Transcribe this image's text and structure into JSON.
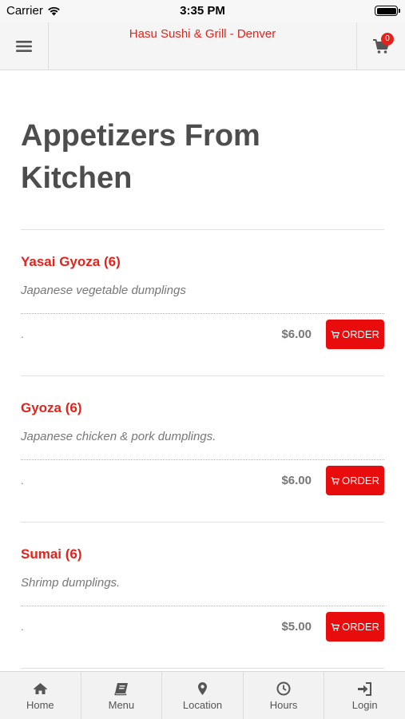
{
  "status_bar": {
    "carrier": "Carrier",
    "time": "3:35 PM"
  },
  "navbar": {
    "title": "Hasu Sushi & Grill - Denver",
    "cart_count": "0"
  },
  "section": {
    "title": "Appetizers From Kitchen"
  },
  "items": [
    {
      "name": "Yasai Gyoza (6)",
      "description": "Japanese vegetable dumplings",
      "note": ".",
      "price": "$6.00",
      "order_label": "ORDER"
    },
    {
      "name": "Gyoza (6)",
      "description": "Japanese chicken & pork dumplings.",
      "note": ".",
      "price": "$6.00",
      "order_label": "ORDER"
    },
    {
      "name": "Sumai (6)",
      "description": "Shrimp dumplings.",
      "note": ".",
      "price": "$5.00",
      "order_label": "ORDER"
    }
  ],
  "tabbar": {
    "tabs": [
      {
        "label": "Home",
        "icon": "home-icon"
      },
      {
        "label": "Menu",
        "icon": "book-icon"
      },
      {
        "label": "Location",
        "icon": "map-marker-icon"
      },
      {
        "label": "Hours",
        "icon": "clock-icon"
      },
      {
        "label": "Login",
        "icon": "sign-in-icon"
      }
    ]
  },
  "colors": {
    "brand_red": "#e3231b",
    "button_red": "#e80c0c",
    "heading_gray": "#4d4d4d",
    "text_gray": "#777777"
  }
}
